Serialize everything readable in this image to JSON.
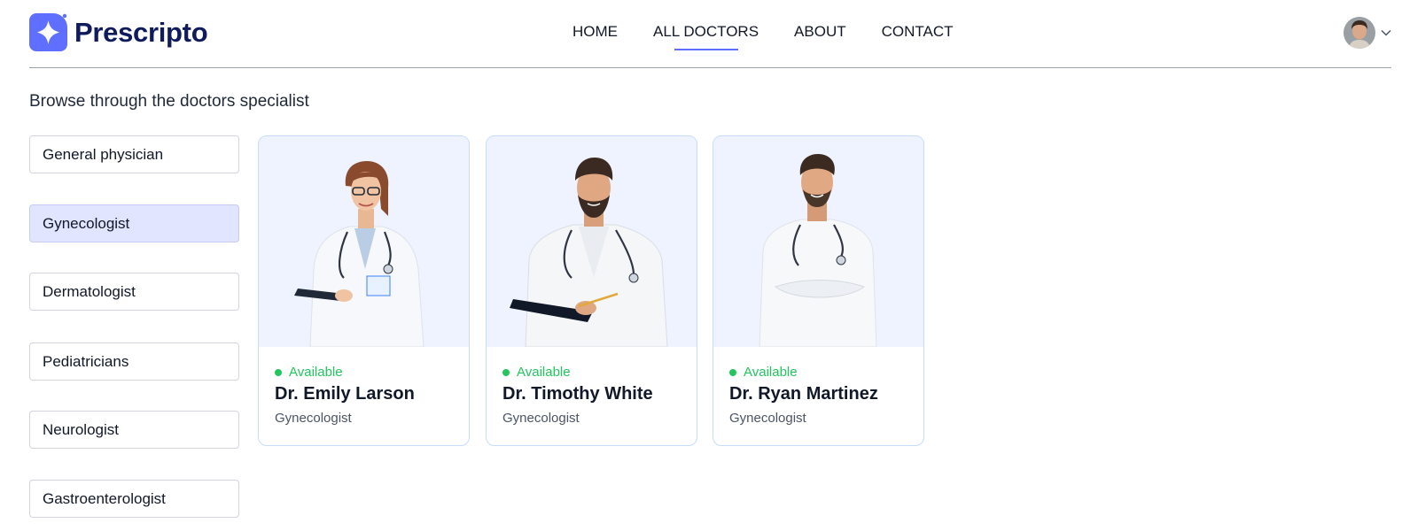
{
  "brand": {
    "name": "Prescripto",
    "accent": "#5f6fff"
  },
  "nav": {
    "items": [
      {
        "label": "HOME"
      },
      {
        "label": "ALL DOCTORS",
        "active": true
      },
      {
        "label": "ABOUT"
      },
      {
        "label": "CONTACT"
      }
    ]
  },
  "profile": {
    "icon": "chevron-down-icon"
  },
  "page": {
    "intro": "Browse through the doctors specialist"
  },
  "filters": {
    "items": [
      {
        "label": "General physician"
      },
      {
        "label": "Gynecologist",
        "active": true
      },
      {
        "label": "Dermatologist"
      },
      {
        "label": "Pediatricians"
      },
      {
        "label": "Neurologist"
      },
      {
        "label": "Gastroenterologist"
      }
    ]
  },
  "doctors": [
    {
      "status": "Available",
      "name": "Dr. Emily Larson",
      "speciality": "Gynecologist"
    },
    {
      "status": "Available",
      "name": "Dr. Timothy White",
      "speciality": "Gynecologist"
    },
    {
      "status": "Available",
      "name": "Dr. Ryan Martinez",
      "speciality": "Gynecologist"
    }
  ],
  "colors": {
    "available": "#22c55e",
    "card_bg": "#eef3ff",
    "active_filter": "#e2e5ff",
    "brand_dark": "#0f1b5c"
  }
}
